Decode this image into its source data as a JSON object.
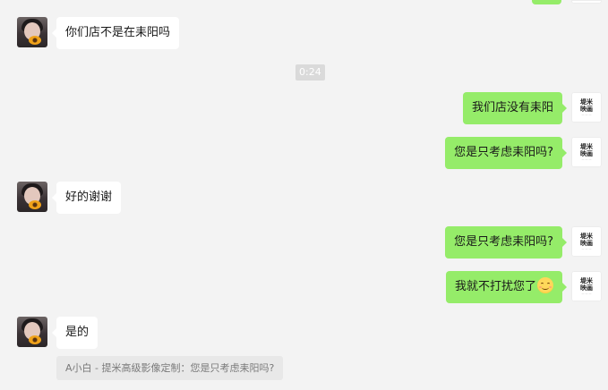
{
  "timestamp": "0:24",
  "contact_avatar": "portrait-with-sunflower",
  "self_avatar": {
    "line1": "堤米",
    "line2": "映画"
  },
  "messages": [
    {
      "side": "left",
      "text": "你们店不是在耒阳吗"
    },
    {
      "side": "right",
      "text": "我们店没有耒阳"
    },
    {
      "side": "right",
      "text": "您是只考虑耒阳吗?"
    },
    {
      "side": "left",
      "text": "好的谢谢"
    },
    {
      "side": "right",
      "text": "您是只考虑耒阳吗?"
    },
    {
      "side": "right",
      "text": "我就不打扰您了",
      "emoji": "smiling-face-icon"
    },
    {
      "side": "left",
      "text": "是的"
    }
  ],
  "quote": "A小白 - 提米高级影像定制：您是只考虑耒阳吗?",
  "colors": {
    "background": "#f3f3f3",
    "self_bubble": "#95ec69",
    "contact_bubble": "#ffffff",
    "timestamp_bg": "#dadada",
    "quote_bg": "#e8e8e8"
  }
}
